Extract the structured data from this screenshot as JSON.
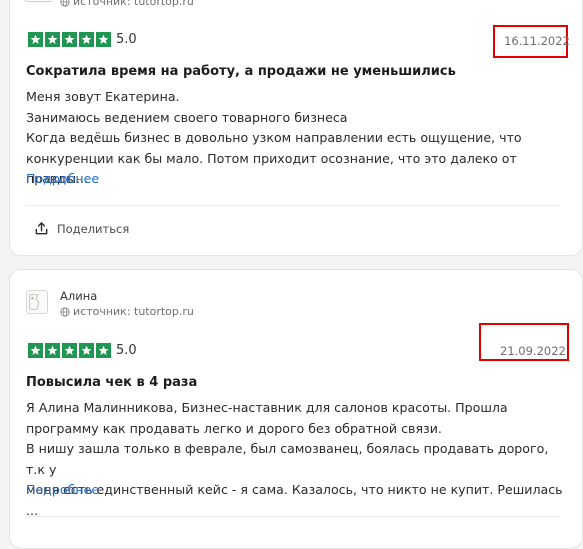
{
  "reviews": [
    {
      "source_text": "источник: tutortop.ru",
      "rating": 5,
      "rating_text": "5.0",
      "date": "16.11.2022",
      "title": "Сократила время на работу, а продажи не уменьшились",
      "body": "Меня зовут Екатерина.\nЗанимаюсь ведением своего товарного бизнеса\nКогда ведёшь бизнес в довольно узком направлении есть ощущение, что\nконкуренции как бы мало. Потом приходит осознание, что это далеко от правды...",
      "more_label": "Подробнее",
      "share_label": "Поделиться"
    },
    {
      "author": "Алина",
      "source_text": "источник: tutortop.ru",
      "rating": 5,
      "rating_text": "5.0",
      "date": "21.09.2022",
      "title": "Повысила чек в 4 раза",
      "body": "Я Алина Малинникова, Бизнес-наставник для салонов красоты. Прошла\nпрограмму как продавать легко и дорого без обратной связи.\nВ нишу зашла только в феврале, был самозванец, боялась продавать дорого, т.к у\nменя есть единственный кейс - я сама. Казалось, что никто не купит. Решилась ...",
      "more_label": "Подробнее"
    }
  ],
  "colors": {
    "star_bg": "#219653",
    "highlight": "#e00000",
    "link": "#1f6ad1"
  },
  "icons": {
    "source": "globe-icon",
    "share": "share-icon",
    "star": "star-icon"
  }
}
